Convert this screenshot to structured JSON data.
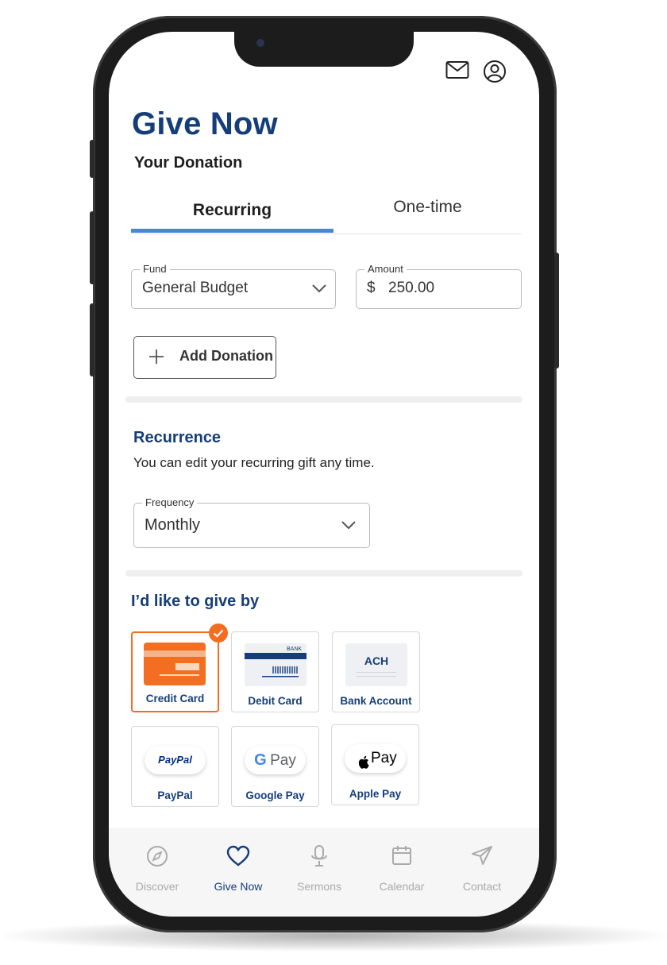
{
  "header": {
    "title": "Give Now",
    "subtitle": "Your Donation"
  },
  "tabs": [
    {
      "label": "Recurring",
      "active": true
    },
    {
      "label": "One-time",
      "active": false
    }
  ],
  "donation": {
    "fund_label": "Fund",
    "fund_value": "General Budget",
    "amount_label": "Amount",
    "currency_symbol": "$",
    "amount_value": "250.00",
    "add_button": "Add Donation"
  },
  "recurrence": {
    "title": "Recurrence",
    "description": "You can edit your recurring gift any time.",
    "frequency_label": "Frequency",
    "frequency_value": "Monthly"
  },
  "payment": {
    "title": "I’d like to give by",
    "methods": [
      {
        "label": "Credit Card",
        "selected": true
      },
      {
        "label": "Debit Card",
        "selected": false,
        "card_text": "BANK"
      },
      {
        "label": "Bank Account",
        "selected": false,
        "card_text": "ACH"
      },
      {
        "label": "PayPal",
        "selected": false,
        "logo_text": "PayPal"
      },
      {
        "label": "Google Pay",
        "selected": false,
        "logo_text": "Pay"
      },
      {
        "label": "Apple Pay",
        "selected": false,
        "logo_text": "Pay"
      }
    ]
  },
  "bottom_nav": [
    {
      "label": "Discover",
      "icon": "compass-icon",
      "active": false
    },
    {
      "label": "Give Now",
      "icon": "heart-icon",
      "active": true
    },
    {
      "label": "Sermons",
      "icon": "microphone-icon",
      "active": false
    },
    {
      "label": "Calendar",
      "icon": "calendar-icon",
      "active": false
    },
    {
      "label": "Contact",
      "icon": "paper-plane-icon",
      "active": false
    }
  ],
  "colors": {
    "brand_blue": "#153d7a",
    "accent_blue": "#4a86d8",
    "accent_orange": "#f36e21"
  }
}
